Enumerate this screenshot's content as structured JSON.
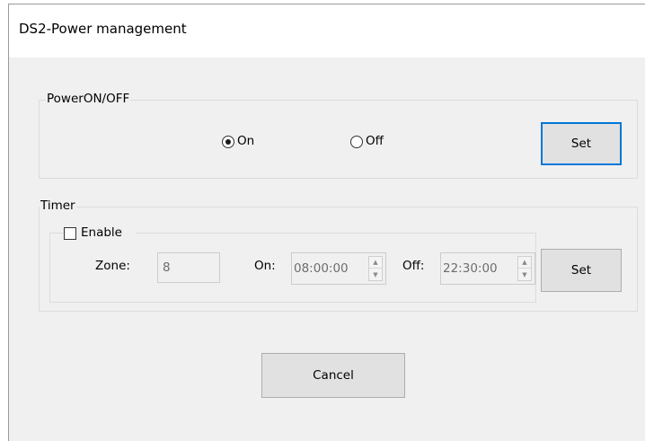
{
  "window": {
    "title": "DS2-Power management"
  },
  "power": {
    "legend": "PowerON/OFF",
    "on_label": "On",
    "off_label": "Off",
    "selected": "On",
    "set_label": "Set"
  },
  "timer": {
    "legend": "Timer",
    "enable_label": "Enable",
    "enable_checked": false,
    "zone_label": "Zone:",
    "zone_value": "8",
    "on_label": "On:",
    "on_value": "08:00:00",
    "off_label": "Off:",
    "off_value": "22:30:00",
    "set_label": "Set",
    "spin_up_icon": "▲",
    "spin_down_icon": "▼"
  },
  "footer": {
    "cancel_label": "Cancel"
  },
  "colors": {
    "focus_border": "#0078d7",
    "dialog_bg": "#f0f0f0",
    "button_bg": "#e1e1e1"
  }
}
